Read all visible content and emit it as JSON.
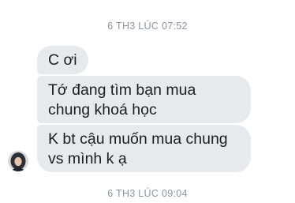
{
  "conversation": {
    "timestamp_top": "6 TH3 LÚC 07:52",
    "messages": [
      {
        "text": "C ơi"
      },
      {
        "text": "Tớ đang tìm bạn mua chung khoá học"
      },
      {
        "text": "K bt cậu muốn mua chung vs mình k ạ"
      }
    ],
    "timestamp_bottom": "6 TH3 LÚC 09:04"
  },
  "colors": {
    "background": "#ffffff",
    "bubble": "#e8e9ec",
    "text": "#1c1e21",
    "timestamp": "#8d949e"
  }
}
